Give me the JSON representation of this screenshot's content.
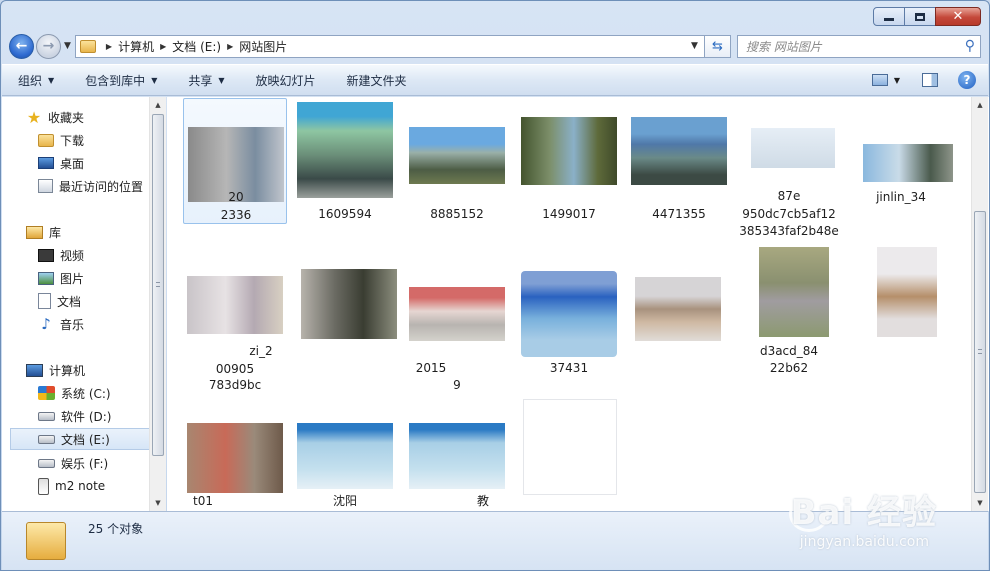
{
  "address": {
    "crumbs": [
      "计算机",
      "文档 (E:)",
      "网站图片"
    ]
  },
  "search": {
    "placeholder": "搜索 网站图片"
  },
  "toolbar": {
    "organize": "组织",
    "include_library": "包含到库中",
    "share": "共享",
    "slideshow": "放映幻灯片",
    "new_folder": "新建文件夹"
  },
  "navpane": {
    "favorites": "收藏夹",
    "downloads": "下载",
    "desktop": "桌面",
    "recent": "最近访问的位置",
    "libraries": "库",
    "videos": "视频",
    "pictures": "图片",
    "documents": "文档",
    "music": "音乐",
    "computer": "计算机",
    "drive_c": "系统 (C:)",
    "drive_d": "软件 (D:)",
    "drive_e": "文档 (E:)",
    "drive_f": "娱乐 (F:)",
    "m2note": "m2 note"
  },
  "files": [
    {
      "line1": "20",
      "line2": "2336"
    },
    {
      "line1": "",
      "line2": "1609594"
    },
    {
      "line1": "",
      "line2": "8885152"
    },
    {
      "line1": "",
      "line2": "1499017"
    },
    {
      "line1": "",
      "line2": "4471355"
    },
    {
      "line1": "87e",
      "line2": "950dc7cb5af12",
      "line3": "385343faf2b48e"
    },
    {
      "line1": "jinlin_34"
    },
    {
      "line1": "zi_2",
      "line2": "00905",
      "line3": "783d9bc"
    },
    {
      "line1": ""
    },
    {
      "line1": "2015",
      "line2": "9"
    },
    {
      "line1": "37431"
    },
    {
      "line1": ""
    },
    {
      "line1": "d3acd_84",
      "line2": "22b62"
    },
    {
      "line1": ""
    },
    {
      "line1": "t01"
    },
    {
      "line1": "沈阳"
    },
    {
      "line1": "教"
    },
    {
      "line1": ""
    }
  ],
  "status": {
    "count": "25 个对象"
  },
  "watermark": {
    "brand": "Bai 经验",
    "url": "jingyan.baidu.com"
  }
}
